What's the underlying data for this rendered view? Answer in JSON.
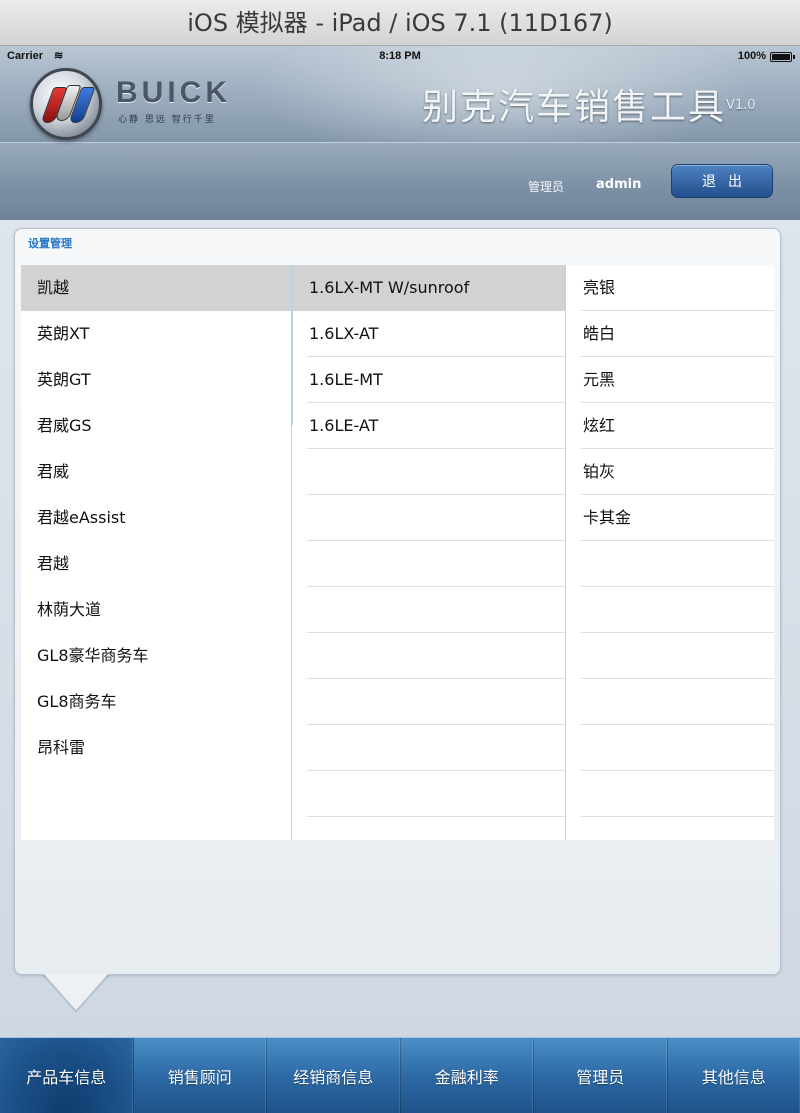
{
  "simulator": {
    "title": "iOS 模拟器 - iPad / iOS 7.1 (11D167)"
  },
  "statusbar": {
    "carrier": "Carrier",
    "wifi_icon": "wifi-icon",
    "time": "8:18 PM",
    "battery": "100%"
  },
  "header": {
    "brand": "BUICK",
    "brand_sub": "心静 思远 智行千里",
    "app_title": "别克汽车销售工具",
    "version": "V1.0",
    "admin_label": "管理员",
    "admin_name": "admin",
    "logout_label": "退出"
  },
  "panel": {
    "title": "设置管理",
    "models": [
      "凯越",
      "英朗XT",
      "英朗GT",
      "君威GS",
      "君威",
      "君越eAssist",
      "君越",
      "林荫大道",
      "GL8豪华商务车",
      "GL8商务车",
      "昂科雷"
    ],
    "selected_model_index": 0,
    "trims": [
      "1.6LX-MT W/sunroof",
      "1.6LX-AT",
      "1.6LE-MT",
      "1.6LE-AT",
      "",
      "",
      "",
      "",
      "",
      "",
      "",
      ""
    ],
    "selected_trim_index": 0,
    "colors": [
      "亮银",
      "皓白",
      "元黑",
      "炫红",
      "铂灰",
      "卡其金",
      "",
      "",
      "",
      "",
      "",
      ""
    ]
  },
  "tabs": [
    {
      "label": "产品车信息",
      "active": true
    },
    {
      "label": "销售顾问",
      "active": false
    },
    {
      "label": "经销商信息",
      "active": false
    },
    {
      "label": "金融利率",
      "active": false
    },
    {
      "label": "管理员",
      "active": false
    },
    {
      "label": "其他信息",
      "active": false
    }
  ],
  "colors_theme": {
    "accent": "#2a78c7",
    "tab_bg": "#2d6aa6",
    "logout_bg": "#234f8d"
  }
}
